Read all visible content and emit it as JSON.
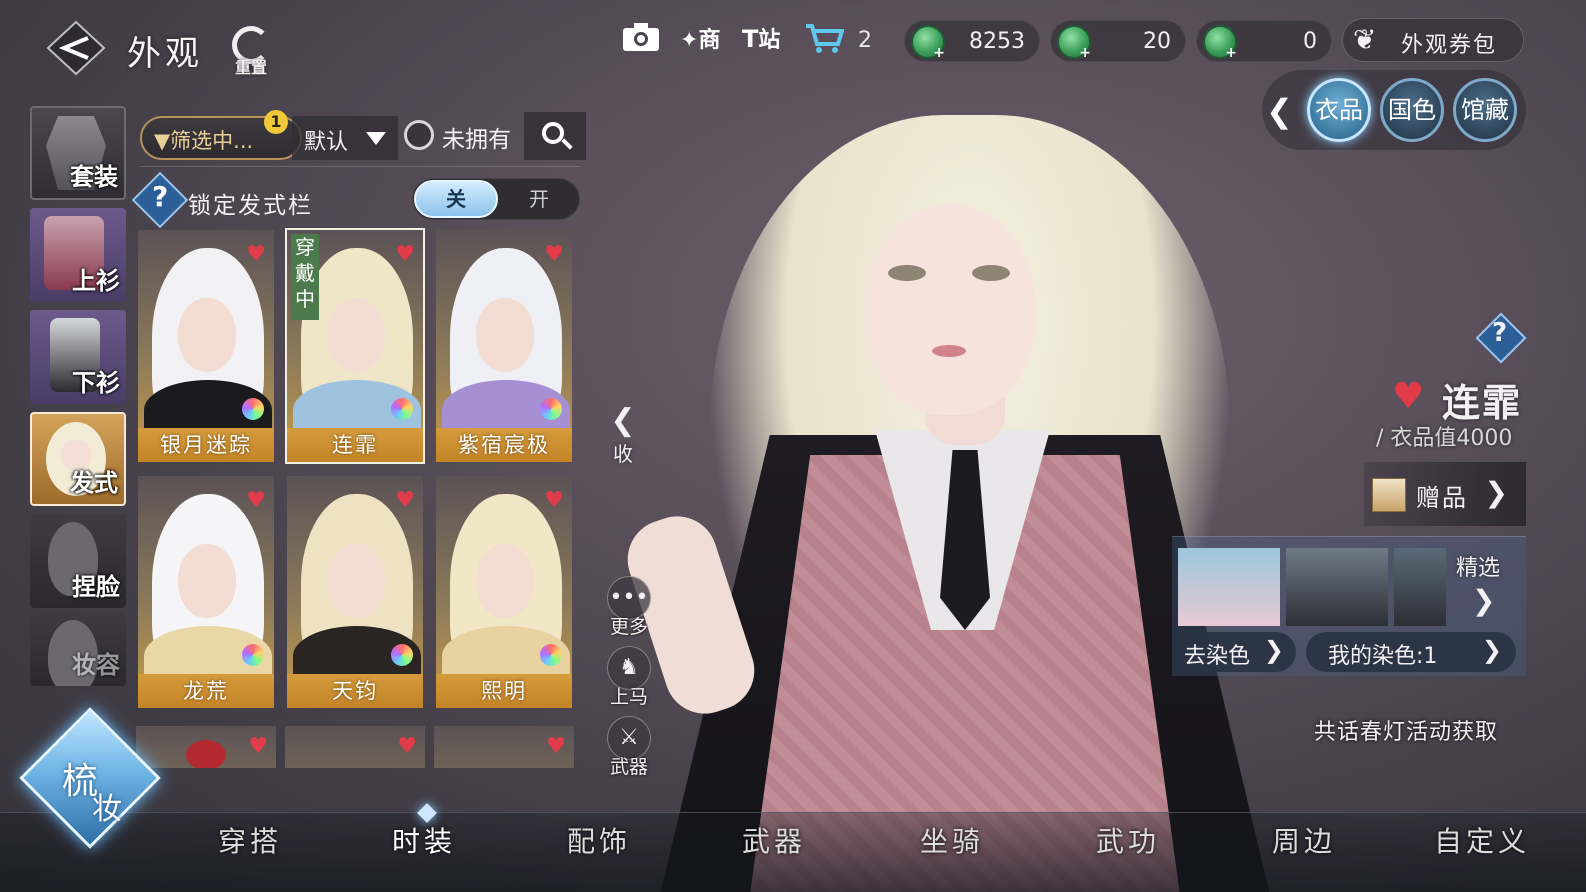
{
  "header": {
    "title": "外观",
    "reset_label": "重置",
    "camera_icon": "camera-icon",
    "shop_label": "商",
    "station_label": "站",
    "cart_count": "2"
  },
  "currencies": [
    {
      "value": "8253"
    },
    {
      "value": "20"
    },
    {
      "value": "0"
    }
  ],
  "coupon_label": "外观券包",
  "right_tabs": [
    "衣品",
    "国色",
    "馆藏"
  ],
  "rail": {
    "items": [
      "套装",
      "上衫",
      "下衫",
      "发式",
      "捏脸",
      "妆容"
    ]
  },
  "filter": {
    "label": "筛选中...",
    "badge": "1",
    "sort_label": "默认",
    "unowned_label": "未拥有"
  },
  "lock": {
    "label": "锁定发式栏",
    "off_label": "关",
    "on_label": "开"
  },
  "hairstyles": [
    {
      "name": "银月迷踪",
      "hair": "#f2f2f4",
      "accent": "#1a1a1f"
    },
    {
      "name": "连霏",
      "hair": "#efe6c8",
      "accent": "#9fc3df",
      "wearing": "穿戴中"
    },
    {
      "name": "紫宿宸极",
      "hair": "#eef0f5",
      "accent": "#a78fd3"
    },
    {
      "name": "龙荒",
      "hair": "#f5f5f7",
      "accent": "#e9d7a6"
    },
    {
      "name": "天钧",
      "hair": "#efe2c2",
      "accent": "#2a2522"
    },
    {
      "name": "熙明",
      "hair": "#f1e7c6",
      "accent": "#e8d2a0"
    }
  ],
  "wearing_chars": [
    "穿",
    "戴",
    "中"
  ],
  "center_buttons": {
    "collapse_label": "收",
    "more_label": "更多",
    "mount_label": "上马",
    "weapon_label": "武器"
  },
  "item": {
    "name": "连霏",
    "value_label": "/ 衣品值4000",
    "gift_label": "赠品"
  },
  "dye": {
    "featured_label": "精选",
    "go_dye_label": "去染色",
    "my_dye_label": "我的染色:1"
  },
  "source_text": "共话春灯活动获取",
  "makeup": {
    "line1": "梳",
    "line2": "妆"
  },
  "bottom_tabs": [
    "穿搭",
    "时装",
    "配饰",
    "武器",
    "坐骑",
    "武功",
    "周边",
    "自定义"
  ],
  "colors": {
    "accent": "#8bd0ff",
    "gold": "#d59b3c",
    "heart": "#e23b4a"
  }
}
